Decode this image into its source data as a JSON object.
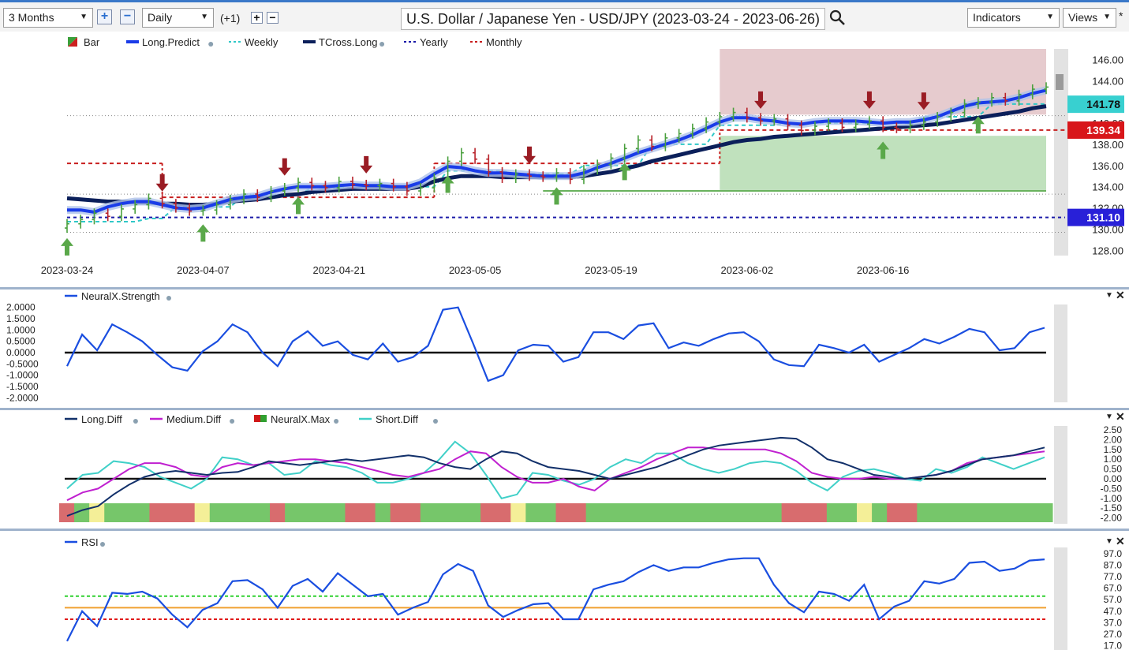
{
  "toolbar": {
    "period": "3 Months",
    "interval": "Daily",
    "offset": "(+1)",
    "title": "U.S. Dollar / Japanese Yen - USD/JPY (2023-03-24 - 2023-06-26)",
    "indicators": "Indicators",
    "views": "Views"
  },
  "colors": {
    "long_predict": "#1a3ce8",
    "tcross_long": "#0b1f5a",
    "weekly": "#30c8c8",
    "yearly": "#1a1aa8",
    "monthly": "#c81e1e",
    "up_arrow": "#5aa84a",
    "down_arrow": "#9a1c24",
    "long_diff": "#12306a",
    "medium_diff": "#c020d0",
    "short_diff": "#40d0c8",
    "strength": "#1a4ee0",
    "rsi": "#1a4ee0"
  },
  "chart_data": [
    {
      "type": "line",
      "panel": "price",
      "title": "U.S. Dollar / Japanese Yen - USD/JPY (2023-03-24 - 2023-06-26)",
      "legend": [
        "Bar",
        "Long.Predict",
        "Weekly",
        "TCross.Long",
        "Yearly",
        "Monthly"
      ],
      "x_ticks": [
        "2023-03-24",
        "2023-04-07",
        "2023-04-21",
        "2023-05-05",
        "2023-05-19",
        "2023-06-02",
        "2023-06-16"
      ],
      "y_ticks": [
        "146.00",
        "144.00",
        "142.00",
        "140.00",
        "138.00",
        "136.00",
        "134.00",
        "132.00",
        "130.00",
        "128.00"
      ],
      "ylim": [
        127.5,
        147.0
      ],
      "price_labels": [
        {
          "value": "141.78",
          "color": "#38d0d0"
        },
        {
          "value": "139.34",
          "color": "#d8161a"
        },
        {
          "value": "131.10",
          "color": "#2820d8"
        }
      ],
      "close": [
        130.5,
        130.9,
        131.5,
        131.2,
        131.9,
        132.3,
        132.9,
        132.4,
        132.0,
        131.7,
        131.8,
        132.3,
        132.8,
        133.3,
        133.0,
        133.6,
        133.9,
        134.4,
        134.1,
        133.9,
        134.5,
        134.2,
        134.1,
        134.3,
        134.0,
        133.6,
        133.9,
        134.8,
        136.4,
        137.2,
        136.6,
        135.4,
        134.8,
        135.2,
        135.0,
        134.9,
        135.3,
        134.7,
        135.6,
        136.1,
        136.7,
        137.6,
        138.4,
        137.8,
        138.6,
        139.0,
        139.5,
        140.1,
        140.6,
        141.0,
        140.5,
        140.2,
        140.4,
        139.8,
        139.3,
        139.7,
        140.0,
        139.6,
        139.9,
        140.2,
        139.6,
        139.5,
        139.8,
        140.1,
        140.6,
        141.0,
        141.8,
        142.0,
        142.4,
        142.1,
        142.7,
        143.2,
        143.4
      ],
      "long_predict": [
        131.8,
        131.8,
        131.6,
        132.1,
        132.4,
        132.6,
        132.6,
        132.3,
        132.0,
        131.9,
        132.0,
        132.4,
        132.8,
        133.0,
        133.1,
        133.5,
        133.8,
        134.0,
        134.0,
        134.0,
        134.1,
        134.2,
        134.1,
        134.1,
        134.0,
        134.0,
        134.4,
        135.2,
        135.9,
        135.8,
        135.5,
        135.3,
        135.3,
        135.2,
        135.1,
        135.0,
        135.0,
        135.0,
        135.3,
        135.8,
        136.2,
        136.7,
        137.2,
        137.6,
        138.0,
        138.4,
        138.9,
        139.5,
        140.1,
        140.5,
        140.5,
        140.3,
        140.2,
        140.0,
        139.9,
        140.1,
        140.2,
        140.2,
        140.2,
        140.1,
        140.0,
        140.1,
        140.1,
        140.3,
        140.6,
        141.1,
        141.6,
        141.9,
        142.0,
        142.1,
        142.4,
        142.8,
        143.1
      ],
      "tcross_long": [
        132.9,
        132.8,
        132.7,
        132.6,
        132.6,
        132.5,
        132.5,
        132.4,
        132.4,
        132.3,
        132.3,
        132.4,
        132.6,
        132.7,
        132.8,
        133.0,
        133.2,
        133.3,
        133.5,
        133.6,
        133.7,
        133.8,
        133.8,
        133.8,
        133.8,
        133.8,
        134.0,
        134.5,
        134.8,
        135.0,
        135.0,
        135.0,
        134.9,
        134.9,
        134.9,
        134.9,
        134.9,
        134.9,
        135.0,
        135.2,
        135.4,
        135.7,
        136.0,
        136.4,
        136.7,
        137.0,
        137.3,
        137.6,
        137.9,
        138.2,
        138.4,
        138.5,
        138.7,
        138.8,
        138.9,
        139.0,
        139.1,
        139.2,
        139.3,
        139.4,
        139.5,
        139.6,
        139.7,
        139.8,
        139.9,
        140.1,
        140.3,
        140.5,
        140.7,
        140.9,
        141.1,
        141.4,
        141.6
      ],
      "weekly": [
        130.7,
        130.7,
        130.7,
        130.7,
        130.7,
        130.7,
        131.0,
        131.0,
        132.1,
        132.1,
        132.1,
        132.1,
        132.1,
        133.2,
        133.2,
        133.2,
        133.2,
        133.2,
        133.9,
        133.9,
        133.9,
        133.9,
        133.9,
        134.0,
        134.0,
        134.0,
        134.0,
        134.0,
        135.5,
        135.5,
        135.5,
        135.5,
        135.5,
        135.2,
        135.2,
        135.2,
        135.2,
        135.2,
        136.0,
        136.0,
        136.0,
        136.0,
        136.0,
        138.0,
        138.0,
        138.0,
        138.0,
        138.0,
        139.8,
        139.8,
        139.8,
        139.8,
        139.8,
        140.0,
        140.0,
        140.0,
        140.0,
        140.0,
        140.0,
        140.0,
        140.0,
        140.0,
        140.0,
        140.6,
        140.6,
        140.6,
        140.6,
        140.6,
        141.8,
        141.8,
        141.8,
        141.8,
        141.8
      ],
      "yearly": 131.1,
      "monthly_segments": [
        {
          "from": 0,
          "to": 7,
          "value": 136.2
        },
        {
          "from": 7,
          "to": 27,
          "value": 133.0
        },
        {
          "from": 27,
          "to": 48,
          "value": 136.2
        },
        {
          "from": 48,
          "to": 73,
          "value": 139.34
        }
      ],
      "up_arrows": [
        0,
        10,
        17,
        28,
        36,
        41,
        60,
        67
      ],
      "down_arrows": [
        7,
        16,
        22,
        34,
        51,
        59,
        63
      ]
    },
    {
      "type": "line",
      "panel": "strength",
      "series_name": "NeuralX.Strength",
      "y_ticks": [
        "2.0000",
        "1.5000",
        "1.0000",
        "0.5000",
        "0.0000",
        "-0.5000",
        "-1.0000",
        "-1.5000",
        "-2.0000"
      ],
      "ylim": [
        -2.2,
        2.2
      ],
      "values": [
        -0.6,
        0.8,
        0.1,
        1.25,
        0.9,
        0.5,
        -0.1,
        -0.65,
        -0.8,
        0.05,
        0.5,
        1.25,
        0.9,
        0.0,
        -0.6,
        0.5,
        0.95,
        0.3,
        0.5,
        -0.1,
        -0.3,
        0.4,
        -0.4,
        -0.2,
        0.3,
        1.9,
        2.0,
        0.4,
        -1.25,
        -1.0,
        0.1,
        0.35,
        0.3,
        -0.4,
        -0.2,
        0.9,
        0.9,
        0.6,
        1.2,
        1.3,
        0.2,
        0.45,
        0.3,
        0.6,
        0.85,
        0.9,
        0.5,
        -0.3,
        -0.55,
        -0.6,
        0.35,
        0.2,
        0.0,
        0.35,
        -0.4,
        -0.1,
        0.2,
        0.6,
        0.4,
        0.7,
        1.05,
        0.9,
        0.1,
        0.2,
        0.9,
        1.1
      ]
    },
    {
      "type": "line",
      "panel": "diff",
      "y_ticks": [
        "2.50",
        "2.00",
        "1.50",
        "1.00",
        "0.50",
        "0.00",
        "-0.50",
        "-1.00",
        "-1.50",
        "-2.00"
      ],
      "ylim": [
        -2.3,
        2.7
      ],
      "series": [
        {
          "name": "Long.Diff",
          "values": [
            -1.9,
            -1.6,
            -1.4,
            -0.8,
            -0.3,
            0.1,
            0.3,
            0.4,
            0.3,
            0.2,
            0.3,
            0.35,
            0.6,
            0.9,
            0.8,
            0.7,
            0.8,
            0.9,
            1.0,
            0.9,
            1.0,
            1.1,
            1.2,
            1.1,
            0.8,
            0.6,
            0.5,
            1.0,
            1.4,
            1.3,
            0.9,
            0.6,
            0.5,
            0.4,
            0.2,
            0.0,
            0.2,
            0.4,
            0.6,
            0.9,
            1.2,
            1.5,
            1.7,
            1.8,
            1.9,
            2.0,
            2.1,
            2.05,
            1.6,
            1.0,
            0.8,
            0.5,
            0.2,
            0.1,
            0.0,
            0.1,
            0.2,
            0.4,
            0.7,
            1.0,
            1.1,
            1.2,
            1.4,
            1.6
          ]
        },
        {
          "name": "Medium.Diff",
          "values": [
            -1.1,
            -0.7,
            -0.5,
            0.0,
            0.5,
            0.8,
            0.8,
            0.6,
            0.2,
            0.1,
            0.6,
            0.8,
            0.7,
            0.8,
            0.9,
            1.0,
            1.0,
            0.9,
            0.8,
            0.6,
            0.4,
            0.2,
            0.1,
            0.3,
            0.5,
            1.0,
            1.4,
            1.3,
            0.6,
            0.1,
            -0.2,
            -0.2,
            0.0,
            -0.4,
            -0.6,
            0.0,
            0.3,
            0.6,
            1.0,
            1.3,
            1.6,
            1.6,
            1.5,
            1.5,
            1.5,
            1.5,
            1.3,
            0.9,
            0.3,
            0.1,
            0.0,
            0.0,
            0.1,
            0.0,
            0.0,
            0.1,
            0.2,
            0.4,
            0.8,
            1.0,
            1.1,
            1.2,
            1.3,
            1.4
          ]
        },
        {
          "name": "Short.Diff",
          "values": [
            -0.5,
            0.2,
            0.3,
            0.9,
            0.8,
            0.6,
            0.1,
            -0.2,
            -0.5,
            0.0,
            1.1,
            1.0,
            0.7,
            0.8,
            0.2,
            0.3,
            0.9,
            0.7,
            0.6,
            0.3,
            -0.2,
            -0.2,
            0.0,
            0.3,
            1.0,
            1.9,
            1.3,
            0.2,
            -1.0,
            -0.8,
            0.3,
            0.2,
            -0.1,
            -0.3,
            0.0,
            0.6,
            1.0,
            0.8,
            1.3,
            1.3,
            0.8,
            0.5,
            0.3,
            0.5,
            0.8,
            0.9,
            0.8,
            0.4,
            -0.2,
            -0.6,
            0.1,
            0.4,
            0.5,
            0.3,
            0.0,
            -0.1,
            0.5,
            0.3,
            0.6,
            1.1,
            0.8,
            0.5,
            0.8,
            1.1
          ]
        }
      ],
      "neuralx_max": {
        "name": "NeuralX.Max",
        "colors": {
          "g": "#76c66a",
          "r": "#d86c6e",
          "y": "#f4ef98"
        },
        "blocks": [
          "r",
          "g",
          "y",
          "g",
          "g",
          "g",
          "r",
          "r",
          "r",
          "y",
          "g",
          "g",
          "g",
          "g",
          "r",
          "g",
          "g",
          "g",
          "g",
          "r",
          "r",
          "g",
          "r",
          "r",
          "g",
          "g",
          "g",
          "g",
          "r",
          "r",
          "y",
          "g",
          "g",
          "r",
          "r",
          "g",
          "g",
          "g",
          "g",
          "g",
          "g",
          "g",
          "g",
          "g",
          "g",
          "g",
          "g",
          "g",
          "r",
          "r",
          "r",
          "g",
          "g",
          "y",
          "g",
          "r",
          "r",
          "g",
          "g",
          "g",
          "g",
          "g",
          "g",
          "g",
          "g",
          "g"
        ]
      }
    },
    {
      "type": "line",
      "panel": "rsi",
      "series_name": "RSI",
      "y_ticks": [
        "97.0",
        "87.0",
        "77.0",
        "67.0",
        "57.0",
        "47.0",
        "37.0",
        "27.0",
        "17.0"
      ],
      "ylim": [
        16,
        101
      ],
      "levels": [
        {
          "value": 60,
          "color": "#30d030"
        },
        {
          "value": 50,
          "color": "#f0a030"
        },
        {
          "value": 40,
          "color": "#e01818"
        }
      ],
      "values": [
        21,
        47,
        34,
        63,
        62,
        64,
        58,
        44,
        33,
        48,
        54,
        73,
        74,
        66,
        50,
        69,
        75,
        64,
        80,
        70,
        60,
        62,
        44,
        50,
        55,
        79,
        88,
        82,
        52,
        42,
        48,
        53,
        54,
        40,
        40,
        66,
        70,
        73,
        81,
        87,
        82,
        85,
        85,
        89,
        92,
        93,
        93,
        70,
        54,
        46,
        64,
        62,
        56,
        70,
        40,
        51,
        56,
        73,
        71,
        75,
        89,
        90,
        82,
        84,
        91,
        92
      ]
    }
  ]
}
